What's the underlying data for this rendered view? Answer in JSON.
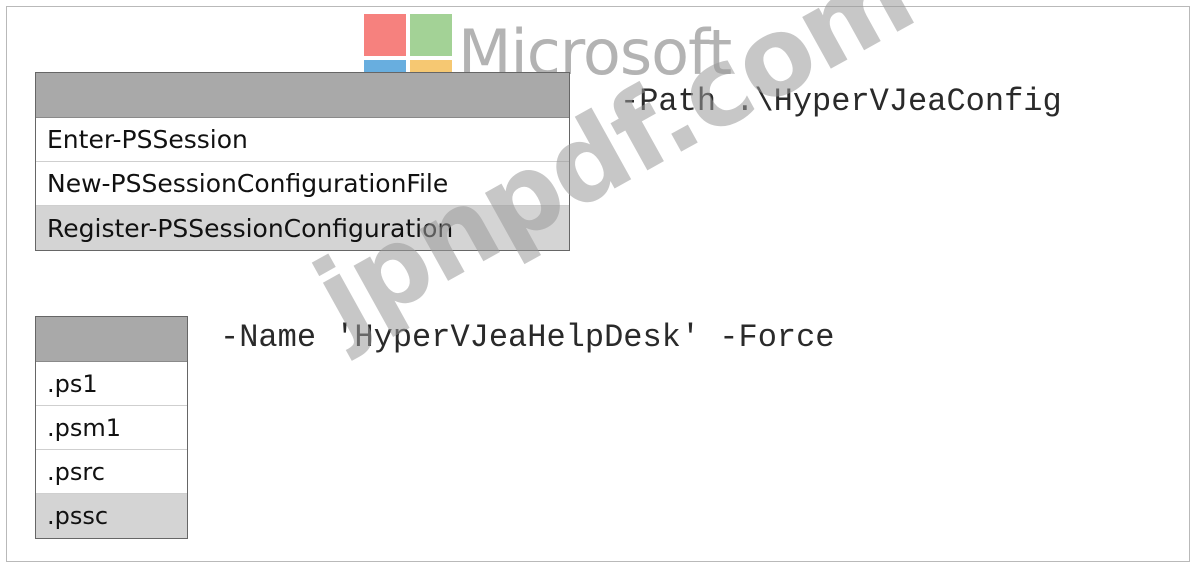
{
  "watermarks": {
    "brand_text": "Microsoft",
    "diagonal_text": "jpnpdf.com",
    "logo_colors": [
      "#f3514d",
      "#80c26f",
      "#2f8fd4",
      "#f3b33c"
    ]
  },
  "dropdown_cmdlet": {
    "options": [
      "Enter-PSSession",
      "New-PSSessionConfigurationFile",
      "Register-PSSessionConfiguration"
    ],
    "selected_index": 2
  },
  "code_line_1": "-Path .\\HyperVJeaConfig",
  "dropdown_extension": {
    "options": [
      ".ps1",
      ".psm1",
      ".psrc",
      ".pssc"
    ],
    "selected_index": 3
  },
  "code_line_2": "-Name 'HyperVJeaHelpDesk' -Force"
}
